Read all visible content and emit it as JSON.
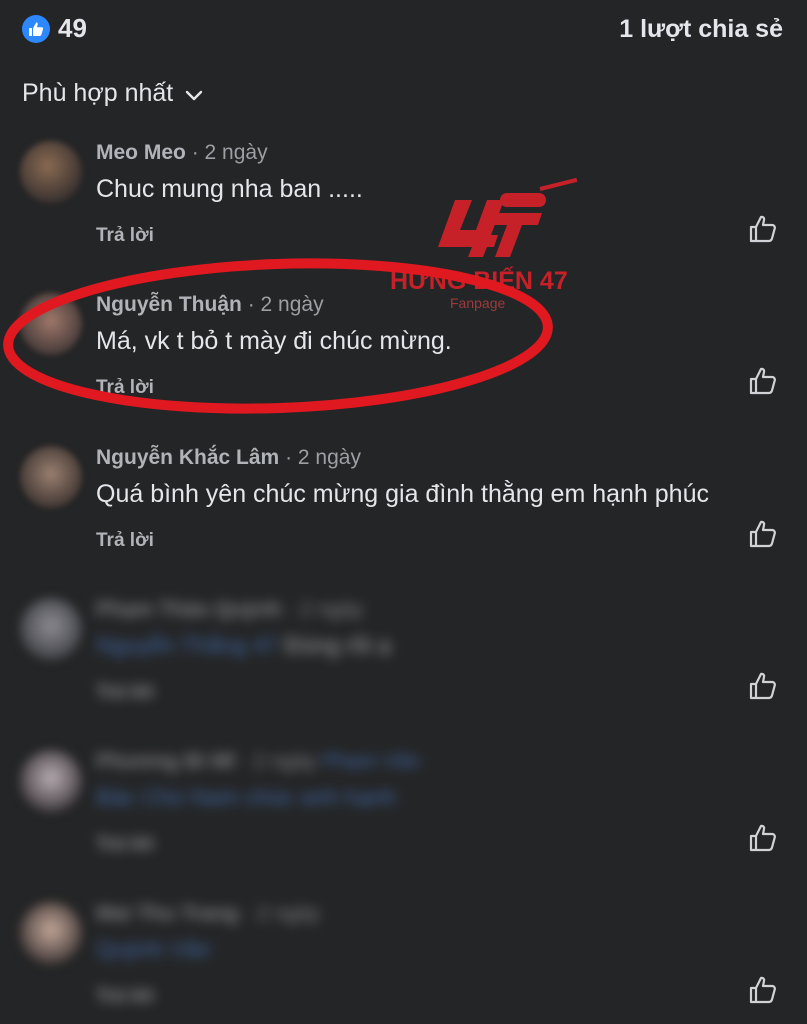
{
  "reactions": {
    "icon": "thumbs-up-icon",
    "count": "49",
    "accent": "#2d88ff"
  },
  "shares": {
    "label": "1 lượt chia sẻ"
  },
  "sort": {
    "label": "Phù hợp nhất",
    "icon": "chevron-down-icon"
  },
  "watermark": {
    "name": "HỨNG BIẾN 47",
    "sub": "Fanpage",
    "color": "#d4212a"
  },
  "comments": [
    {
      "author": "Meo Meo",
      "time": "· 2 ngày",
      "text": "Chuc mung nha ban .....",
      "reply": "Trả lời"
    },
    {
      "author": "Nguyễn Thuận",
      "time": "· 2 ngày",
      "text": "Má, vk t bỏ t mày đi chúc mừng.",
      "reply": "Trả lời"
    },
    {
      "author": "Nguyễn Khắc Lâm",
      "time": "· 2 ngày",
      "text": "Quá bình yên chúc mừng gia đình thằng em hạnh phúc",
      "reply": "Trả lời"
    },
    {
      "author": "Phạm Thảo Quỳnh",
      "time": "· 2 ngày",
      "mention": "Nguyễn Thắng 47",
      "text": "Đúng rồi ạ",
      "reply": "Trả lời"
    },
    {
      "author": "Phương Bì Mĩ",
      "time": "· 2 ngày",
      "mention": "Phạm Văn",
      "text": "Bác Chú Nam chúc anh hạnh",
      "reply": "Trả lời"
    },
    {
      "author": "Mai Thu Trang",
      "time": "· 2 ngày",
      "mention": "Quỳnh Văn",
      "text": "",
      "reply": "Trả lời"
    }
  ]
}
